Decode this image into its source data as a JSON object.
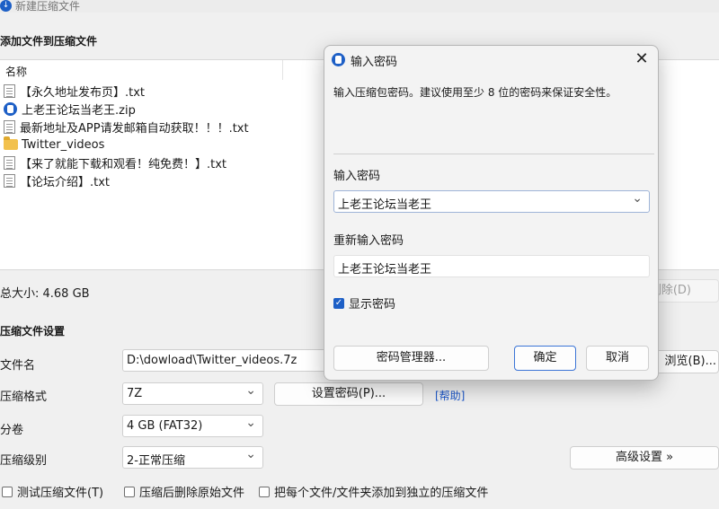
{
  "window": {
    "title": "新建压缩文件"
  },
  "add_section": {
    "title": "添加文件到压缩文件"
  },
  "file_list": {
    "column_name": "名称",
    "items": [
      {
        "name": "【永久地址发布页】.txt",
        "icon": "text-file-icon"
      },
      {
        "name": "上老王论坛当老王.zip",
        "icon": "zip-file-icon"
      },
      {
        "name": "最新地址及APP请发邮箱自动获取！！！.txt",
        "icon": "text-file-icon"
      },
      {
        "name": "Twitter_videos",
        "icon": "folder-icon"
      },
      {
        "name": "【来了就能下载和观看！纯免费！】.txt",
        "icon": "text-file-icon"
      },
      {
        "name": "【论坛介绍】.txt",
        "icon": "text-file-icon"
      }
    ]
  },
  "total_size": "总大小: 4.68 GB",
  "delete_button": "删除(D)",
  "settings": {
    "title": "压缩文件设置",
    "filename_label": "文件名",
    "filename_value": "D:\\dowload\\Twitter_videos.7z",
    "browse_button": "浏览(B)...",
    "format_label": "压缩格式",
    "format_value": "7Z",
    "set_password_button": "设置密码(P)...",
    "help_link": "[帮助]",
    "split_label": "分卷",
    "split_value": "4 GB (FAT32)",
    "level_label": "压缩级别",
    "level_value": "2-正常压缩",
    "advanced_button": "高级设置 »",
    "test_checkbox": "测试压缩文件(T)",
    "delete_after_checkbox": "压缩后删除原始文件",
    "separate_checkbox": "把每个文件/文件夹添加到独立的压缩文件"
  },
  "password_dialog": {
    "title": "输入密码",
    "description": "输入压缩包密码。建议使用至少 8 位的密码来保证安全性。",
    "password_label": "输入密码",
    "password_value": "上老王论坛当老王",
    "confirm_label": "重新输入密码",
    "confirm_value": "上老王论坛当老王",
    "show_password": "显示密码",
    "show_password_checked": true,
    "manager_button": "密码管理器...",
    "ok_button": "确定",
    "cancel_button": "取消"
  },
  "colors": {
    "accent": "#1d5fc6",
    "link": "#1a56c9"
  }
}
